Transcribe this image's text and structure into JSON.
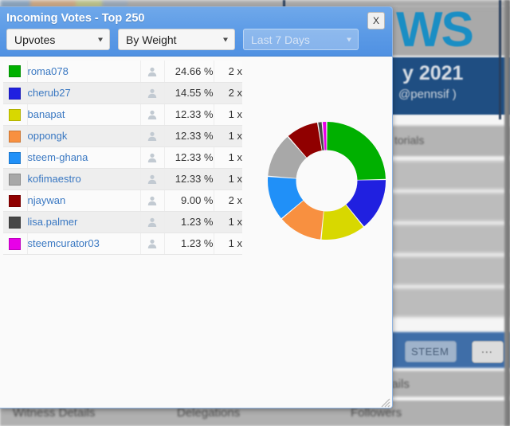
{
  "dialog": {
    "title": "Incoming Votes - Top 250",
    "close_label": "X",
    "filters": [
      {
        "name": "vote-type",
        "value": "Upvotes",
        "disabled": false
      },
      {
        "name": "sort-order",
        "value": "By Weight",
        "disabled": false
      },
      {
        "name": "time-range",
        "value": "Last 7 Days",
        "disabled": true
      }
    ]
  },
  "votes": [
    {
      "color": "#00b000",
      "name": "roma078",
      "percent": "24.66 %",
      "count": "2 x"
    },
    {
      "color": "#2020e0",
      "name": "cherub27",
      "percent": "14.55 %",
      "count": "2 x"
    },
    {
      "color": "#d8d800",
      "name": "banapat",
      "percent": "12.33 %",
      "count": "1 x"
    },
    {
      "color": "#f89040",
      "name": "oppongk",
      "percent": "12.33 %",
      "count": "1 x"
    },
    {
      "color": "#2090f8",
      "name": "steem-ghana",
      "percent": "12.33 %",
      "count": "1 x"
    },
    {
      "color": "#a8a8a8",
      "name": "kofimaestro",
      "percent": "12.33 %",
      "count": "1 x"
    },
    {
      "color": "#900000",
      "name": "njaywan",
      "percent": "9.00 %",
      "count": "2 x"
    },
    {
      "color": "#484848",
      "name": "lisa.palmer",
      "percent": "1.23 %",
      "count": "1 x"
    },
    {
      "color": "#e800e8",
      "name": "steemcurator03",
      "percent": "1.23 %",
      "count": "1 x"
    }
  ],
  "chart_data": {
    "type": "pie",
    "title": "Incoming Votes - Top 250",
    "subtype": "donut",
    "legend_position": "left-table",
    "start_angle_deg": 0,
    "direction": "clockwise",
    "inner_radius_ratio": 0.52,
    "labels": [
      "roma078",
      "cherub27",
      "banapat",
      "oppongk",
      "steem-ghana",
      "kofimaestro",
      "njaywan",
      "lisa.palmer",
      "steemcurator03"
    ],
    "values": [
      24.66,
      14.55,
      12.33,
      12.33,
      12.33,
      12.33,
      9.0,
      1.23,
      1.23
    ],
    "colors": [
      "#00b000",
      "#2020e0",
      "#d8d800",
      "#f89040",
      "#2090f8",
      "#a8a8a8",
      "#900000",
      "#484848",
      "#e800e8"
    ],
    "vote_counts": [
      2,
      2,
      1,
      1,
      1,
      1,
      2,
      1,
      1
    ],
    "unit": "%"
  },
  "background": {
    "logo_text": "WS",
    "banner_title": "y 2021",
    "banner_subtitle": "@pennsif )",
    "card_label": "torials",
    "steem_button": "STEEM",
    "more_button": "...",
    "details_label": "Details",
    "witness_details_label": "Witness Details",
    "delegations_label": "Delegations",
    "followers_label": "Followers"
  }
}
